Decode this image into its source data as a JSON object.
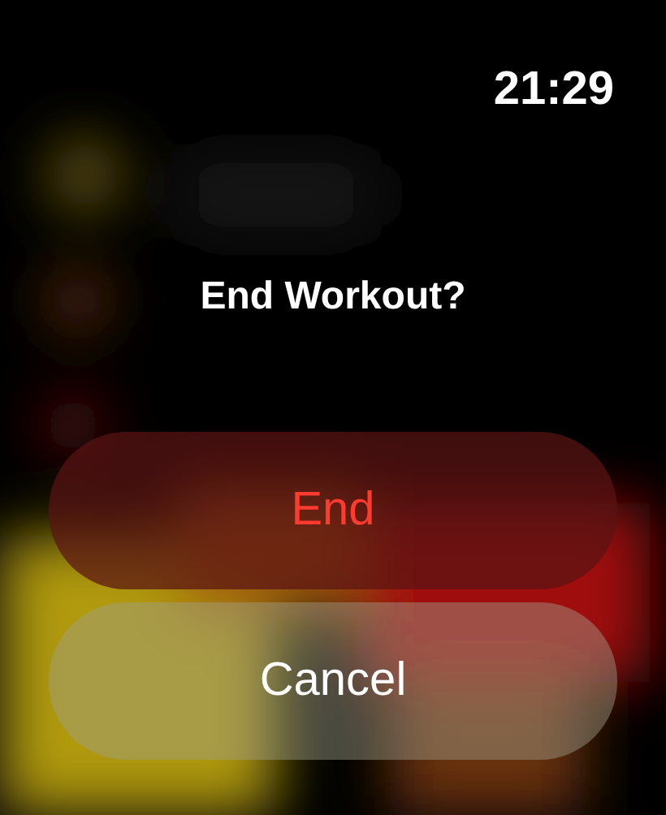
{
  "time": "21:29",
  "title": "End Workout?",
  "buttons": [
    {
      "label": "End",
      "kind": "destructive"
    },
    {
      "label": "Cancel",
      "kind": "default"
    }
  ]
}
